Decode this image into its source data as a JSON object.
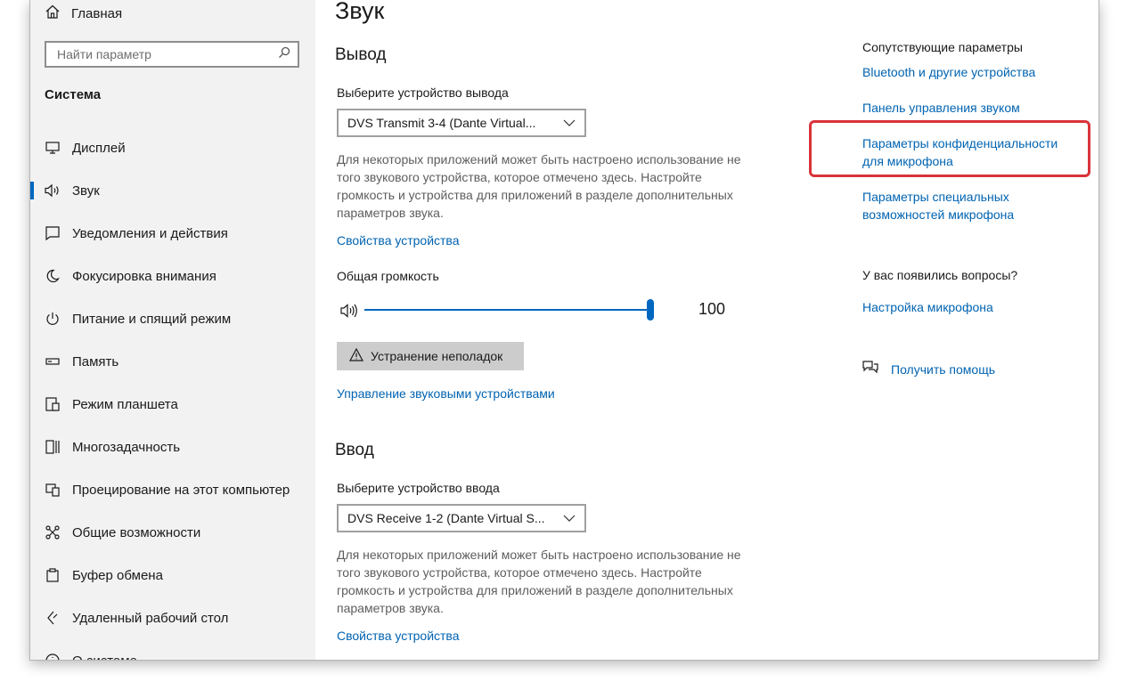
{
  "sidebar": {
    "home_label": "Главная",
    "search_placeholder": "Найти параметр",
    "section_title": "Система",
    "items": [
      {
        "label": "Дисплей",
        "icon": "display-icon"
      },
      {
        "label": "Звук",
        "icon": "speaker-icon",
        "selected": true
      },
      {
        "label": "Уведомления и действия",
        "icon": "notifications-icon"
      },
      {
        "label": "Фокусировка внимания",
        "icon": "moon-icon"
      },
      {
        "label": "Питание и спящий режим",
        "icon": "power-icon"
      },
      {
        "label": "Память",
        "icon": "storage-icon"
      },
      {
        "label": "Режим планшета",
        "icon": "tablet-icon"
      },
      {
        "label": "Многозадачность",
        "icon": "multitasking-icon"
      },
      {
        "label": "Проецирование на этот компьютер",
        "icon": "projecting-icon"
      },
      {
        "label": "Общие возможности",
        "icon": "shared-experiences-icon"
      },
      {
        "label": "Буфер обмена",
        "icon": "clipboard-icon"
      },
      {
        "label": "Удаленный рабочий стол",
        "icon": "remote-desktop-icon"
      },
      {
        "label": "О системе",
        "icon": "info-icon"
      }
    ]
  },
  "main": {
    "title": "Звук",
    "output": {
      "heading": "Вывод",
      "select_label": "Выберите устройство вывода",
      "device": "DVS Transmit  3-4 (Dante Virtual...",
      "description": "Для некоторых приложений может быть настроено использование не того звукового устройства, которое отмечено здесь. Настройте громкость и устройства для приложений в разделе дополнительных параметров звука.",
      "properties_link": "Свойства устройства",
      "volume_label": "Общая громкость",
      "volume_value": "100",
      "volume_level": 1.0,
      "troubleshoot_label": "Устранение неполадок",
      "manage_link": "Управление звуковыми устройствами"
    },
    "input": {
      "heading": "Ввод",
      "select_label": "Выберите устройство ввода",
      "device": "DVS Receive  1-2 (Dante Virtual S...",
      "description": "Для некоторых приложений может быть настроено использование не того звукового устройства, которое отмечено здесь. Настройте громкость и устройства для приложений в разделе дополнительных параметров звука.",
      "properties_link": "Свойства устройства"
    }
  },
  "related": {
    "heading": "Сопутствующие параметры",
    "links": [
      "Bluetooth и другие устройства",
      "Панель управления звуком",
      "Параметры конфиденциальности для микрофона",
      "Параметры специальных возможностей микрофона"
    ],
    "questions_heading": "У вас появились вопросы?",
    "mic_setup_link": "Настройка микрофона",
    "help_link": "Получить помощь"
  },
  "colors": {
    "accent": "#0067c0",
    "link": "#0063b1",
    "highlight": "#d9333a",
    "sidebar_bg": "#f2f2f2"
  }
}
